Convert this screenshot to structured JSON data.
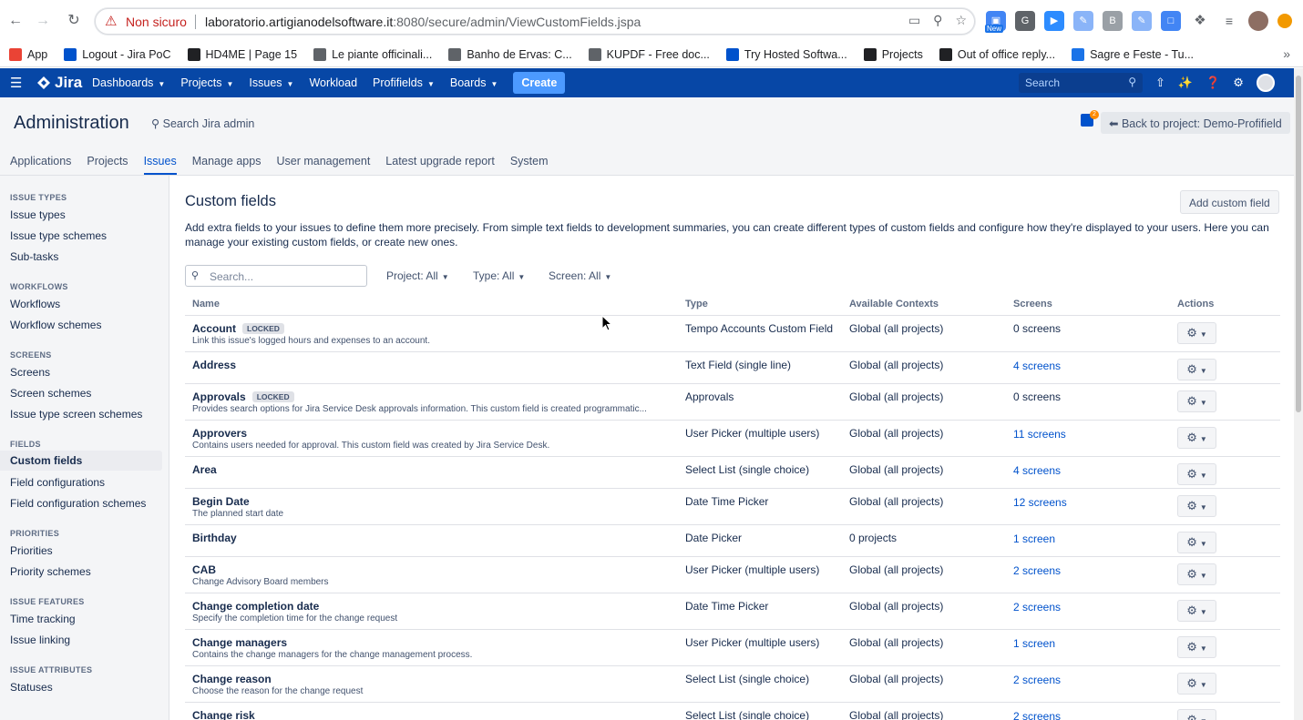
{
  "browser": {
    "insecure_label": "Non sicuro",
    "url_host": "laboratorio.artigianodelsoftware.it",
    "url_rest": ":8080/secure/admin/ViewCustomFields.jspa",
    "ext_new_badge": "New",
    "bookmarks": [
      {
        "label": "App",
        "icon": "apps-grid-icon",
        "color": "#ea4335"
      },
      {
        "label": "Logout - Jira PoC",
        "icon": "jira-icon",
        "color": "#0052cc"
      },
      {
        "label": "HD4ME | Page 15",
        "icon": "hd4me-icon",
        "color": "#202124"
      },
      {
        "label": "Le piante officinali...",
        "icon": "globe-icon",
        "color": "#5f6368"
      },
      {
        "label": "Banho de Ervas: C...",
        "icon": "leaf-icon",
        "color": "#5f6368"
      },
      {
        "label": "KUPDF - Free doc...",
        "icon": "kupdf-icon",
        "color": "#5f6368"
      },
      {
        "label": "Try Hosted Softwa...",
        "icon": "atlassian-icon",
        "color": "#0052cc"
      },
      {
        "label": "Projects",
        "icon": "globe-icon",
        "color": "#202124"
      },
      {
        "label": "Out of office reply...",
        "icon": "atlassian-icon",
        "color": "#202124"
      },
      {
        "label": "Sagre e Feste - Tu...",
        "icon": "sagre-icon",
        "color": "#1a73e8"
      }
    ]
  },
  "jira": {
    "logo": "Jira",
    "menu": [
      {
        "label": "Dashboards",
        "dropdown": true
      },
      {
        "label": "Projects",
        "dropdown": true
      },
      {
        "label": "Issues",
        "dropdown": true
      },
      {
        "label": "Workload",
        "dropdown": false
      },
      {
        "label": "Profifields",
        "dropdown": true
      },
      {
        "label": "Boards",
        "dropdown": true
      }
    ],
    "create_label": "Create",
    "search_placeholder": "Search"
  },
  "admin": {
    "title": "Administration",
    "search_label": "Search Jira admin",
    "feedback_count": "2",
    "back_label": "Back to project: Demo-Profifield",
    "tabs": [
      "Applications",
      "Projects",
      "Issues",
      "Manage apps",
      "User management",
      "Latest upgrade report",
      "System"
    ],
    "active_tab": "Issues"
  },
  "sidebar": {
    "sections": [
      {
        "heading": "ISSUE TYPES",
        "items": [
          "Issue types",
          "Issue type schemes",
          "Sub-tasks"
        ]
      },
      {
        "heading": "WORKFLOWS",
        "items": [
          "Workflows",
          "Workflow schemes"
        ]
      },
      {
        "heading": "SCREENS",
        "items": [
          "Screens",
          "Screen schemes",
          "Issue type screen schemes"
        ]
      },
      {
        "heading": "FIELDS",
        "items": [
          "Custom fields",
          "Field configurations",
          "Field configuration schemes"
        ]
      },
      {
        "heading": "PRIORITIES",
        "items": [
          "Priorities",
          "Priority schemes"
        ]
      },
      {
        "heading": "ISSUE FEATURES",
        "items": [
          "Time tracking",
          "Issue linking"
        ]
      },
      {
        "heading": "ISSUE ATTRIBUTES",
        "items": [
          "Statuses"
        ]
      }
    ],
    "active_item": "Custom fields"
  },
  "main": {
    "title": "Custom fields",
    "add_label": "Add custom field",
    "description": "Add extra fields to your issues to define them more precisely. From simple text fields to development summaries, you can create different types of custom fields and configure how they're displayed to your users. Here you can manage your existing custom fields, or create new ones.",
    "search_placeholder": "Search...",
    "filters": [
      "Project: All",
      "Type: All",
      "Screen: All"
    ],
    "columns": [
      "Name",
      "Type",
      "Available Contexts",
      "Screens",
      "Actions"
    ],
    "locked_label": "LOCKED",
    "rows": [
      {
        "name": "Account",
        "locked": true,
        "desc": "Link this issue's logged hours and expenses to an account.",
        "type": "Tempo Accounts Custom Field",
        "contexts": "Global (all projects)",
        "screens": "0 screens",
        "screens_link": false
      },
      {
        "name": "Address",
        "locked": false,
        "desc": "",
        "type": "Text Field (single line)",
        "contexts": "Global (all projects)",
        "screens": "4 screens",
        "screens_link": true
      },
      {
        "name": "Approvals",
        "locked": true,
        "desc": "Provides search options for Jira Service Desk approvals information. This custom field is created programmatic...",
        "type": "Approvals",
        "contexts": "Global (all projects)",
        "screens": "0 screens",
        "screens_link": false
      },
      {
        "name": "Approvers",
        "locked": false,
        "desc": "Contains users needed for approval. This custom field was created by Jira Service Desk.",
        "type": "User Picker (multiple users)",
        "contexts": "Global (all projects)",
        "screens": "11 screens",
        "screens_link": true
      },
      {
        "name": "Area",
        "locked": false,
        "desc": "",
        "type": "Select List (single choice)",
        "contexts": "Global (all projects)",
        "screens": "4 screens",
        "screens_link": true
      },
      {
        "name": "Begin Date",
        "locked": false,
        "desc": "The planned start date",
        "type": "Date Time Picker",
        "contexts": "Global (all projects)",
        "screens": "12 screens",
        "screens_link": true
      },
      {
        "name": "Birthday",
        "locked": false,
        "desc": "",
        "type": "Date Picker",
        "contexts": "0 projects",
        "screens": "1 screen",
        "screens_link": true
      },
      {
        "name": "CAB",
        "locked": false,
        "desc": "Change Advisory Board members",
        "type": "User Picker (multiple users)",
        "contexts": "Global (all projects)",
        "screens": "2 screens",
        "screens_link": true
      },
      {
        "name": "Change completion date",
        "locked": false,
        "desc": "Specify the completion time for the change request",
        "type": "Date Time Picker",
        "contexts": "Global (all projects)",
        "screens": "2 screens",
        "screens_link": true
      },
      {
        "name": "Change managers",
        "locked": false,
        "desc": "Contains the change managers for the change management process.",
        "type": "User Picker (multiple users)",
        "contexts": "Global (all projects)",
        "screens": "1 screen",
        "screens_link": true
      },
      {
        "name": "Change reason",
        "locked": false,
        "desc": "Choose the reason for the change request",
        "type": "Select List (single choice)",
        "contexts": "Global (all projects)",
        "screens": "2 screens",
        "screens_link": true
      },
      {
        "name": "Change risk",
        "locked": false,
        "desc": "",
        "type": "Select List (single choice)",
        "contexts": "Global (all projects)",
        "screens": "2 screens",
        "screens_link": true
      }
    ]
  }
}
